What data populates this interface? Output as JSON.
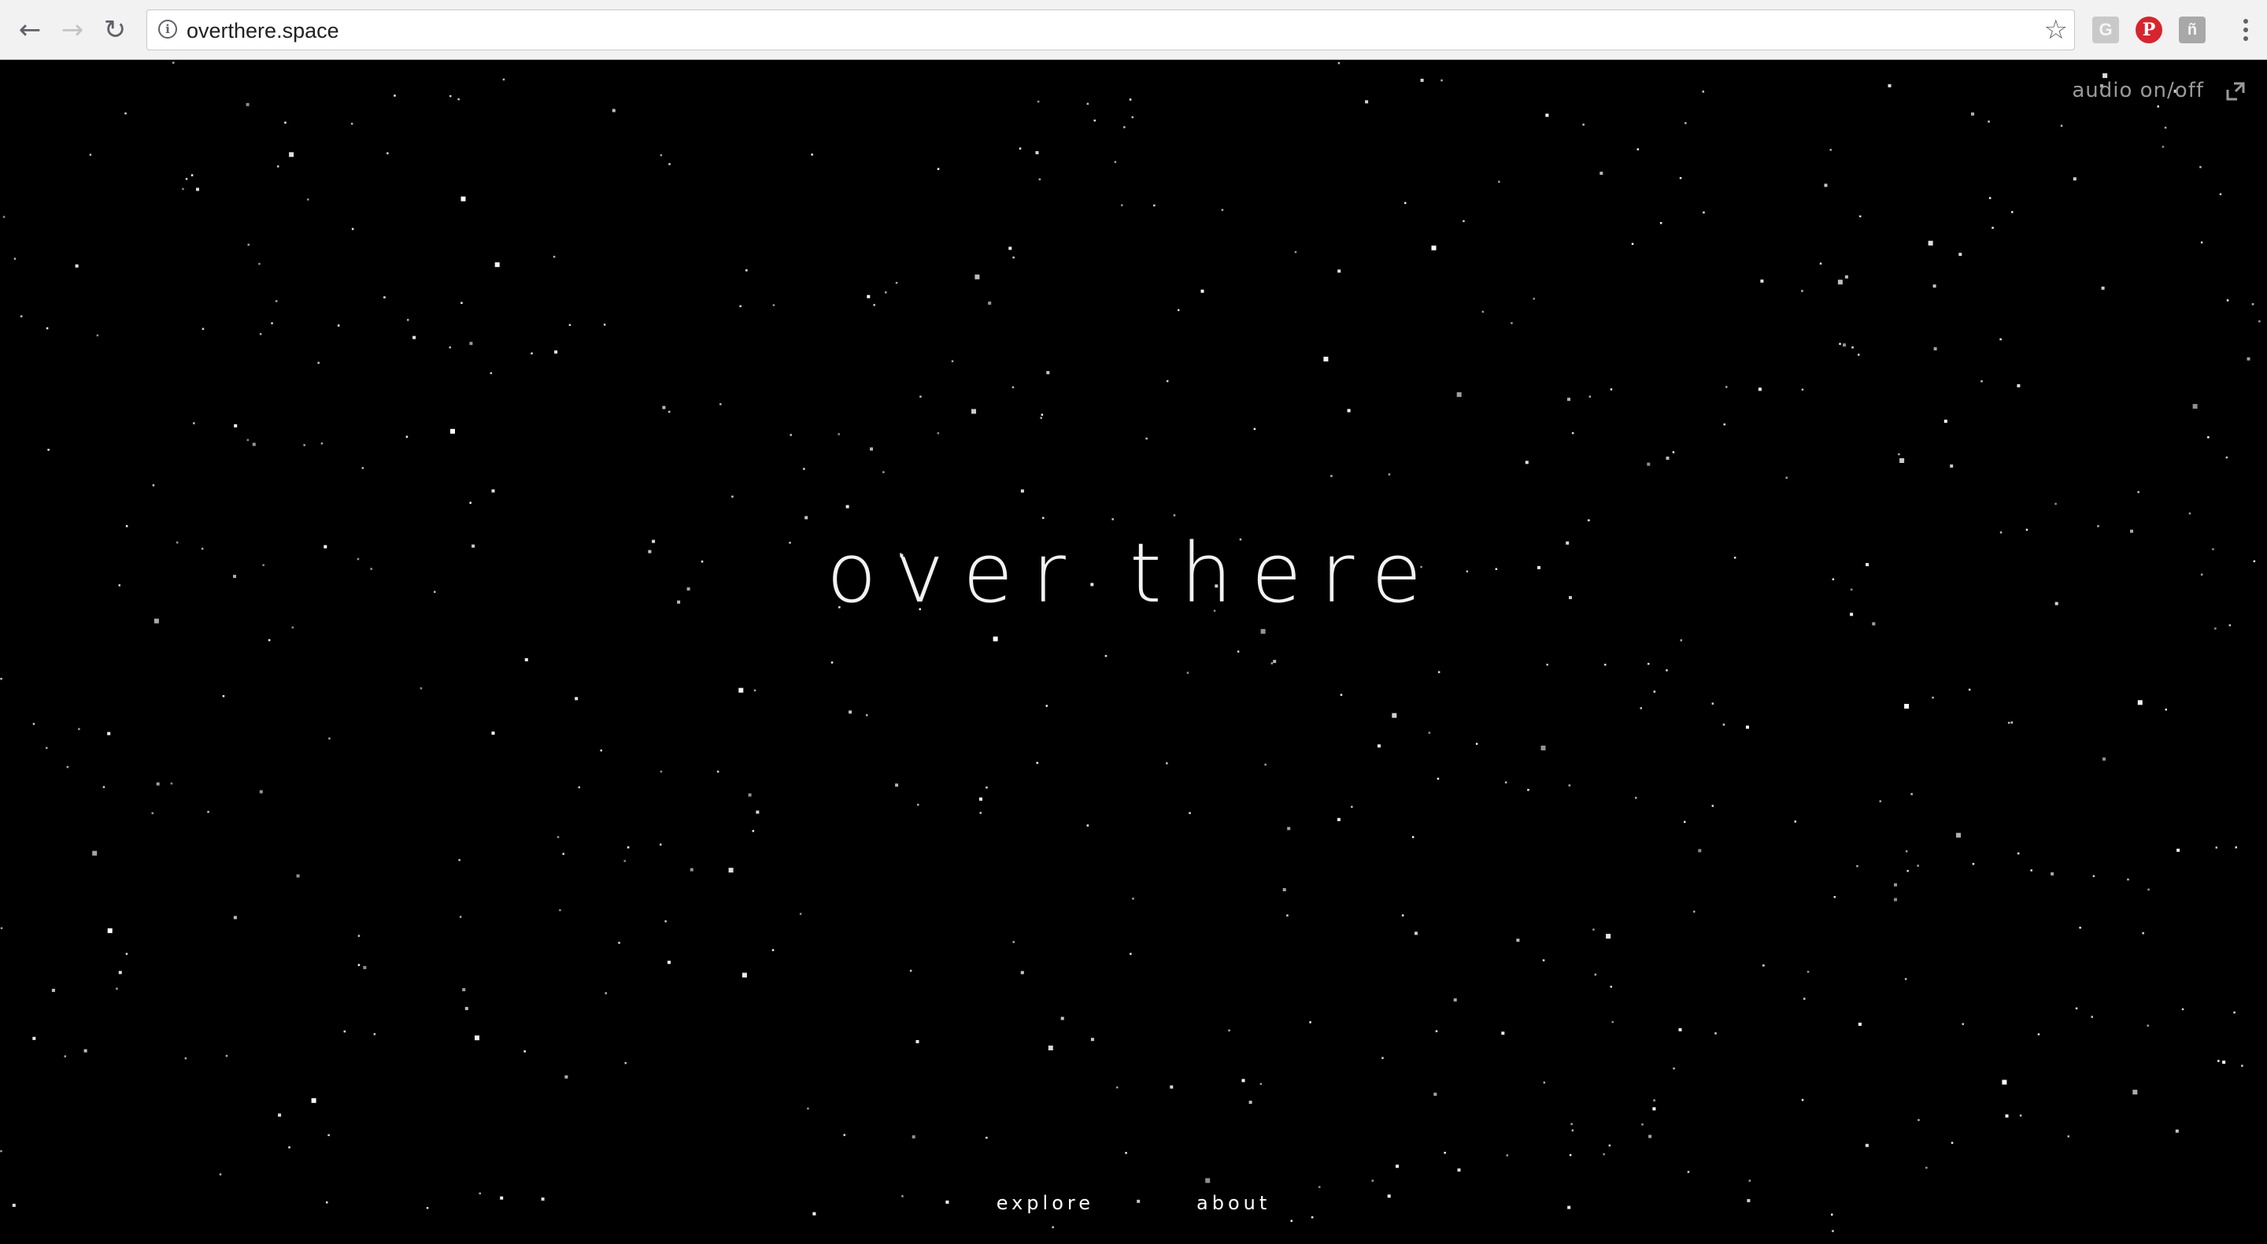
{
  "browser": {
    "url": "overthere.space",
    "icons": {
      "back": "arrow-left-icon",
      "forward": "arrow-right-icon",
      "reload": "reload-icon",
      "site_info": "info-icon",
      "bookmark": "star-icon",
      "menu": "vertical-dots-icon"
    },
    "extensions": [
      {
        "name": "g-extension-icon",
        "glyph": "G"
      },
      {
        "name": "pinterest-icon",
        "glyph": "P"
      },
      {
        "name": "extension-icon",
        "glyph": "ñ"
      }
    ]
  },
  "page": {
    "background": "#000000",
    "title": "over there",
    "audio_toggle": "audio on/off",
    "fullscreen_icon": "fullscreen-icon",
    "nav": {
      "explore": "explore",
      "about": "about"
    },
    "star_color": "#ffffff"
  }
}
